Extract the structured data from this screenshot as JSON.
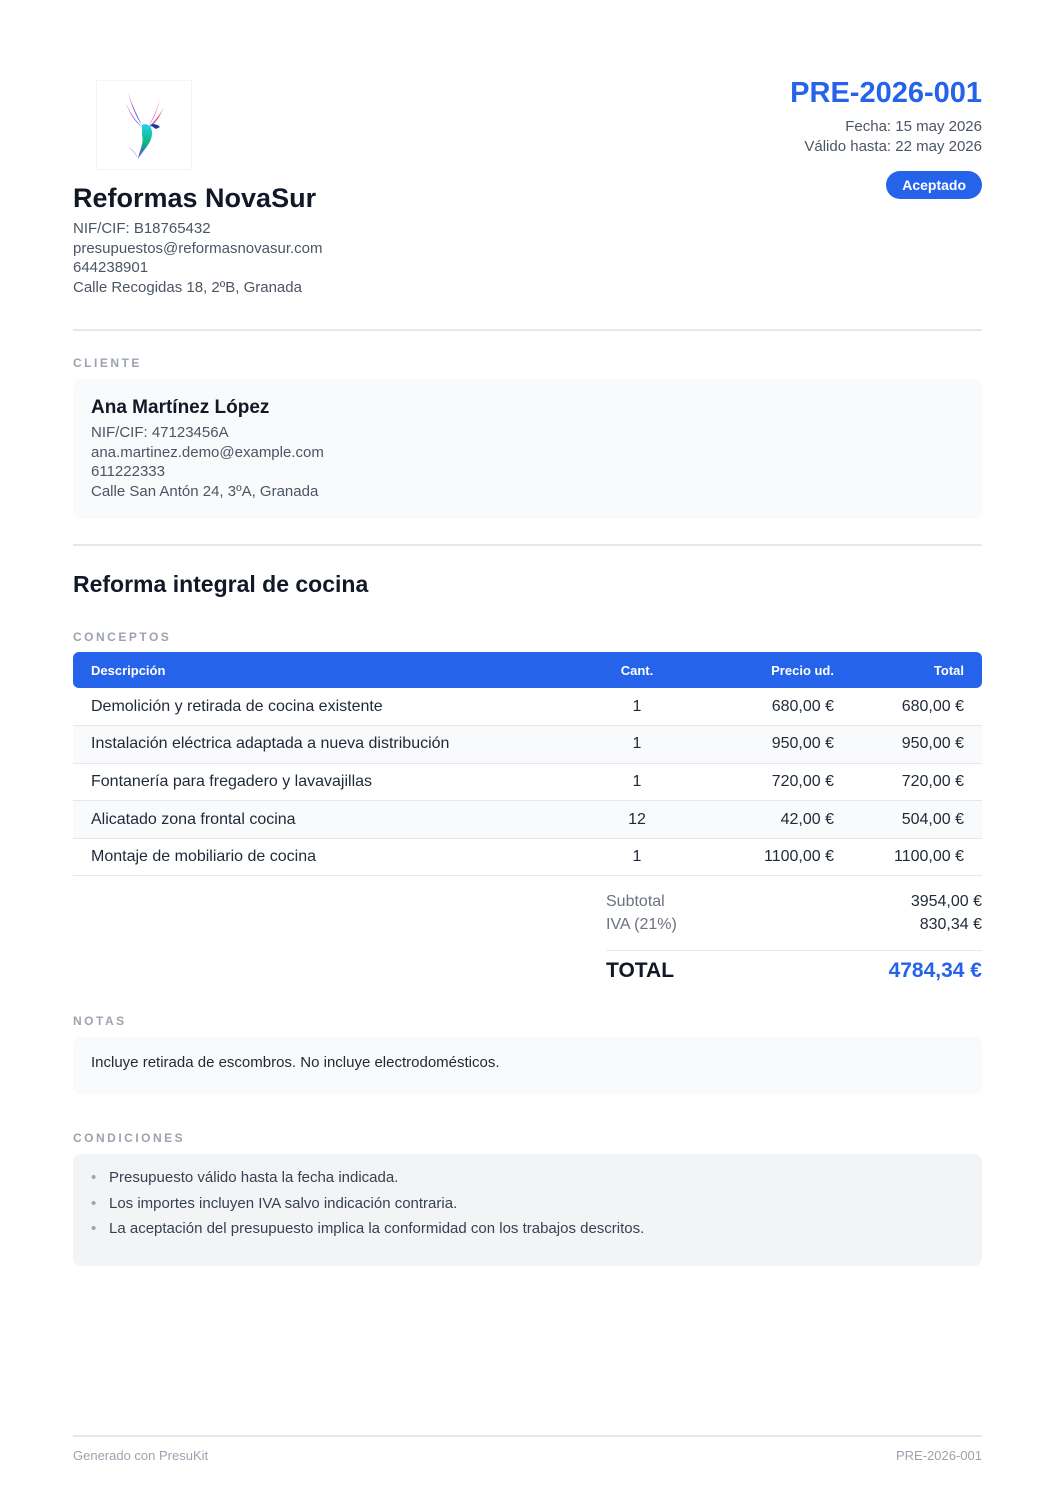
{
  "company": {
    "name": "Reformas NovaSur",
    "nif": "NIF/CIF: B18765432",
    "email": "presupuestos@reformasnovasur.com",
    "phone": "644238901",
    "address": "Calle Recogidas 18, 2ºB, Granada"
  },
  "document": {
    "number": "PRE-2026-001",
    "date": "Fecha: 15 may 2026",
    "valid_until": "Válido hasta: 22 may 2026",
    "status": "Aceptado"
  },
  "client_section": {
    "label": "CLIENTE",
    "name": "Ana Martínez López",
    "nif": "NIF/CIF: 47123456A",
    "email": "ana.martinez.demo@example.com",
    "phone": "611222333",
    "address": "Calle San Antón 24, 3ºA, Granada"
  },
  "project_title": "Reforma integral de cocina",
  "concepts": {
    "label": "CONCEPTOS",
    "headers": {
      "description": "Descripción",
      "quantity": "Cant.",
      "unit_price": "Precio ud.",
      "total": "Total"
    },
    "rows": [
      {
        "description": "Demolición y retirada de cocina existente",
        "quantity": "1",
        "unit_price": "680,00 €",
        "total": "680,00 €"
      },
      {
        "description": "Instalación eléctrica adaptada a nueva distribución",
        "quantity": "1",
        "unit_price": "950,00 €",
        "total": "950,00 €"
      },
      {
        "description": "Fontanería para fregadero y lavavajillas",
        "quantity": "1",
        "unit_price": "720,00 €",
        "total": "720,00 €"
      },
      {
        "description": "Alicatado zona frontal cocina",
        "quantity": "12",
        "unit_price": "42,00 €",
        "total": "504,00 €"
      },
      {
        "description": "Montaje de mobiliario de cocina",
        "quantity": "1",
        "unit_price": "1100,00 €",
        "total": "1100,00 €"
      }
    ]
  },
  "totals": {
    "subtotal_label": "Subtotal",
    "subtotal": "3954,00 €",
    "tax_label": "IVA (21%)",
    "tax": "830,34 €",
    "total_label": "TOTAL",
    "total": "4784,34 €"
  },
  "notes": {
    "label": "NOTAS",
    "text": "Incluye retirada de escombros. No incluye electrodomésticos."
  },
  "conditions": {
    "label": "CONDICIONES",
    "items": [
      "Presupuesto válido hasta la fecha indicada.",
      "Los importes incluyen IVA salvo indicación contraria.",
      "La aceptación del presupuesto implica la conformidad con los trabajos descritos."
    ]
  },
  "footer": {
    "generated_by": "Generado con PresuKit",
    "doc_ref": "PRE-2026-001"
  },
  "colors": {
    "accent": "#2563eb",
    "muted_text": "#4b5563",
    "card_bg": "#f9fafb"
  },
  "icons": {
    "logo": "bird-logo-icon"
  }
}
